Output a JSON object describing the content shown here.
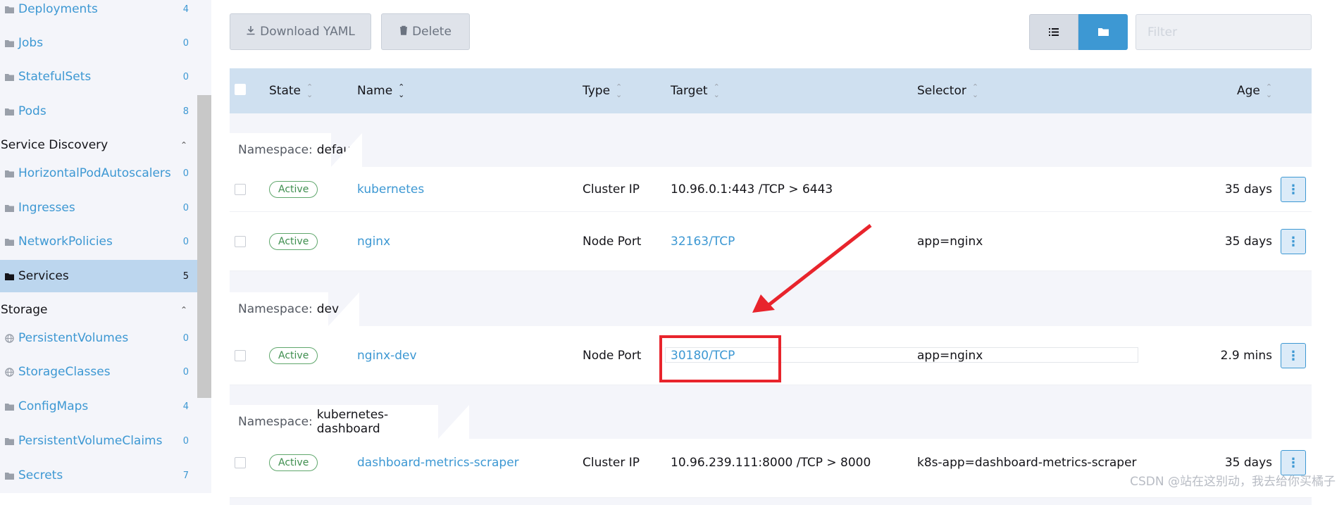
{
  "sidebar": {
    "items_top": [
      {
        "label": "Deployments",
        "count": "4"
      },
      {
        "label": "Jobs",
        "count": "0"
      },
      {
        "label": "StatefulSets",
        "count": "0"
      },
      {
        "label": "Pods",
        "count": "8"
      }
    ],
    "service_discovery": {
      "title": "Service Discovery",
      "items": [
        {
          "label": "HorizontalPodAutoscalers",
          "count": "0"
        },
        {
          "label": "Ingresses",
          "count": "0"
        },
        {
          "label": "NetworkPolicies",
          "count": "0"
        },
        {
          "label": "Services",
          "count": "5"
        }
      ]
    },
    "storage": {
      "title": "Storage",
      "items": [
        {
          "label": "PersistentVolumes",
          "count": "0"
        },
        {
          "label": "StorageClasses",
          "count": "0"
        },
        {
          "label": "ConfigMaps",
          "count": "4"
        },
        {
          "label": "PersistentVolumeClaims",
          "count": "0"
        },
        {
          "label": "Secrets",
          "count": "7"
        }
      ]
    }
  },
  "toolbar": {
    "download_label": "Download YAML",
    "delete_label": "Delete",
    "filter_placeholder": "Filter"
  },
  "table": {
    "columns": [
      "State",
      "Name",
      "Type",
      "Target",
      "Selector",
      "Age"
    ],
    "namespaces": [
      {
        "label": "Namespace:",
        "name": "default",
        "rows": [
          {
            "state": "Active",
            "name": "kubernetes",
            "type": "Cluster IP",
            "target": "10.96.0.1:443 /TCP > 6443",
            "selector": "",
            "age": "35 days"
          },
          {
            "state": "Active",
            "name": "nginx",
            "type": "Node Port",
            "target": "32163/TCP",
            "selector": "app=nginx",
            "age": "35 days"
          }
        ]
      },
      {
        "label": "Namespace:",
        "name": "dev",
        "rows": [
          {
            "state": "Active",
            "name": "nginx-dev",
            "type": "Node Port",
            "target": "30180/TCP",
            "selector": "app=nginx",
            "age": "2.9 mins"
          }
        ]
      },
      {
        "label": "Namespace:",
        "name": "kubernetes-dashboard",
        "rows": [
          {
            "state": "Active",
            "name": "dashboard-metrics-scraper",
            "type": "Cluster IP",
            "target": "10.96.239.111:8000 /TCP > 8000",
            "selector": "k8s-app=dashboard-metrics-scraper",
            "age": "35 days"
          }
        ]
      }
    ]
  },
  "watermark": "CSDN @站在这别动，我去给你买橘子",
  "colors": {
    "accent": "#3d98d3",
    "active_green": "#3e8e4e",
    "annotation_red": "#e8242c"
  }
}
